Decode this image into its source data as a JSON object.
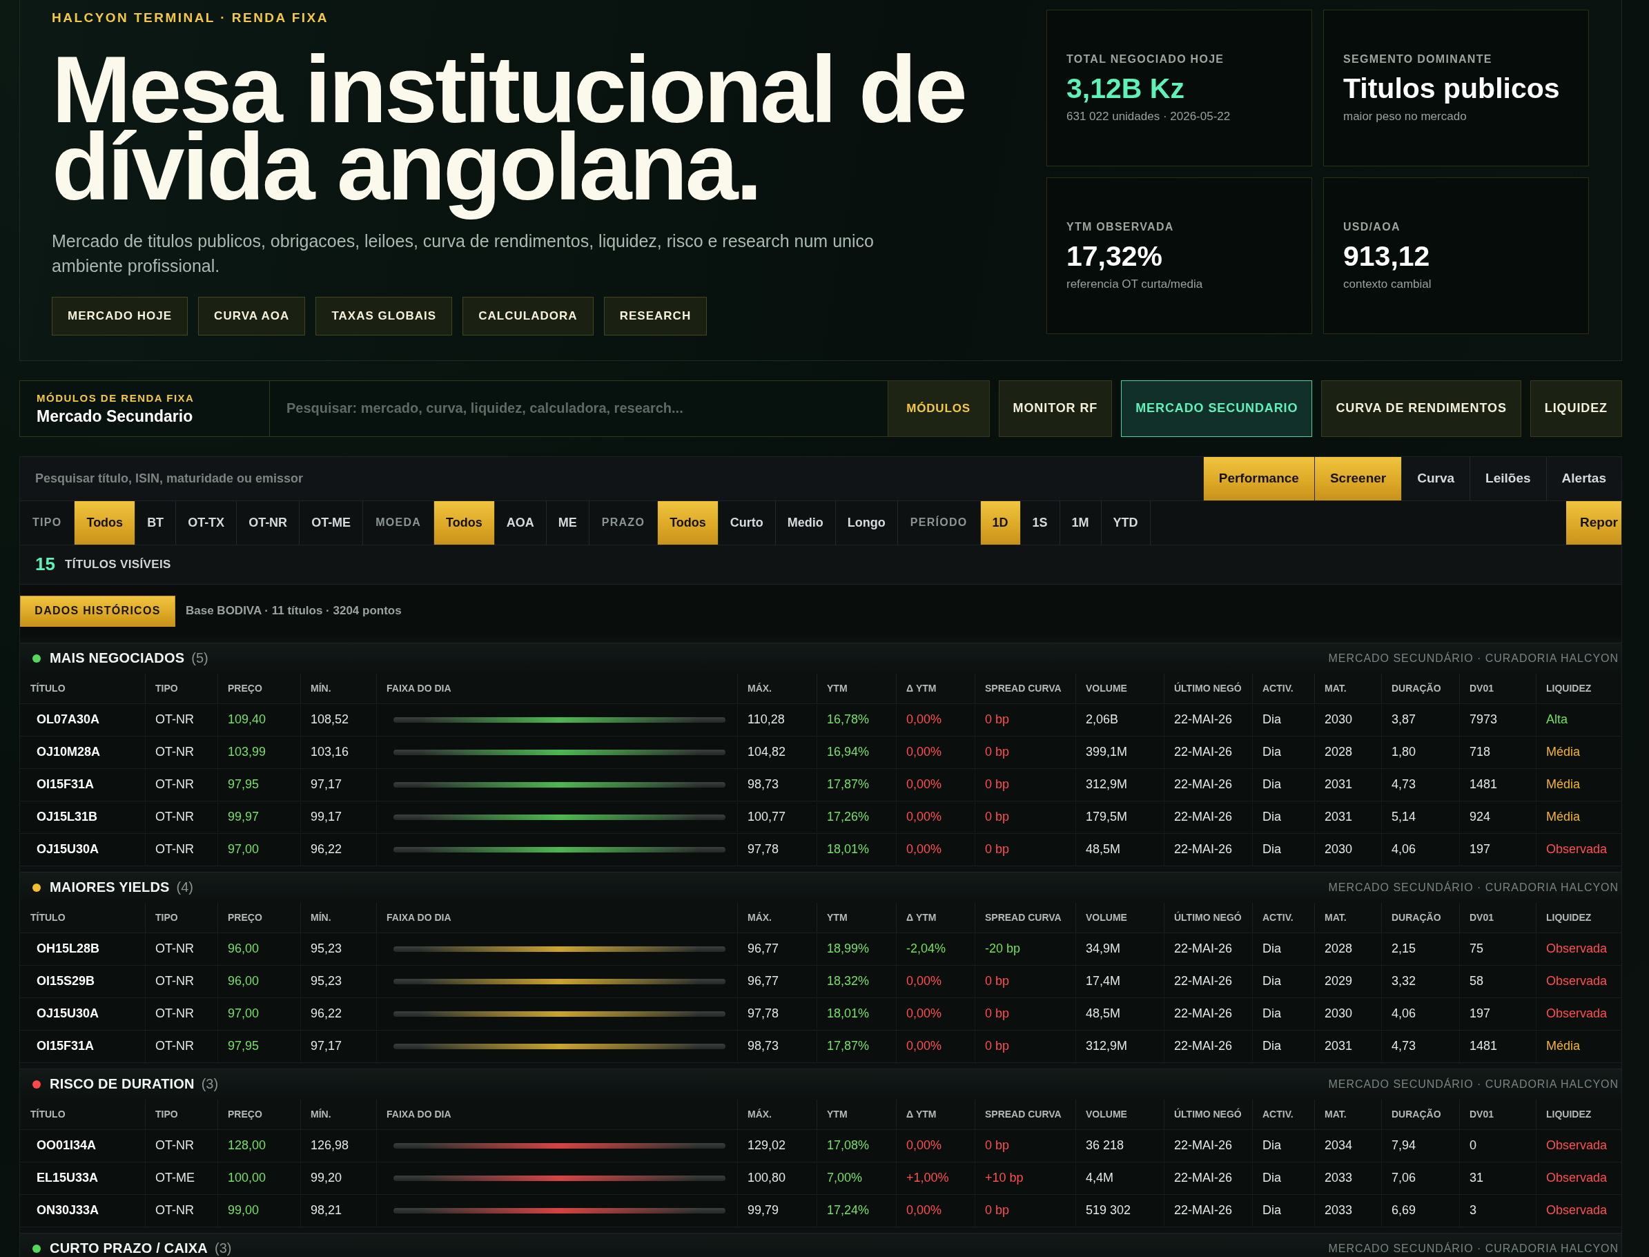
{
  "hero": {
    "kicker": "HALCYON TERMINAL · RENDA FIXA",
    "title": "Mesa institucional de dívida angolana.",
    "subtitle": "Mercado de titulos publicos, obrigacoes, leiloes, curva de rendimentos, liquidez, risco e research num unico ambiente profissional.",
    "buttons": [
      "MERCADO HOJE",
      "CURVA AOA",
      "TAXAS GLOBAIS",
      "CALCULADORA",
      "RESEARCH"
    ]
  },
  "stats": [
    {
      "label": "TOTAL NEGOCIADO HOJE",
      "value": "3,12B Kz",
      "note": "631 022 unidades · 2026-05-22",
      "kind": "accent"
    },
    {
      "label": "SEGMENTO DOMINANTE",
      "value": "Titulos publicos",
      "note": "maior peso no mercado",
      "kind": "plain"
    },
    {
      "label": "YTM OBSERVADA",
      "value": "17,32%",
      "note": "referencia OT curta/media",
      "kind": "plain"
    },
    {
      "label": "USD/AOA",
      "value": "913,12",
      "note": "contexto cambial",
      "kind": "plain"
    }
  ],
  "modules": {
    "kicker": "MÓDULOS DE RENDA FIXA",
    "current": "Mercado Secundario",
    "search": {
      "placeholder": "Pesquisar: mercado, curva, liquidez, calculadora, research..."
    },
    "menu_button": "MÓDULOS",
    "tabs": [
      {
        "label": "MONITOR RF",
        "selected": false
      },
      {
        "label": "MERCADO SECUNDARIO",
        "selected": true
      },
      {
        "label": "CURVA DE RENDIMENTOS",
        "selected": false
      },
      {
        "label": "LIQUIDEZ",
        "selected": false
      }
    ]
  },
  "screener": {
    "search": {
      "placeholder": "Pesquisar título, ISIN, maturidade ou emissor"
    },
    "views": [
      {
        "label": "Performance",
        "selected": true
      },
      {
        "label": "Screener",
        "selected": true
      },
      {
        "label": "Curva",
        "selected": false
      },
      {
        "label": "Leilões",
        "selected": false
      },
      {
        "label": "Alertas",
        "selected": false
      }
    ],
    "filters": [
      {
        "label": "TIPO",
        "options": [
          {
            "label": "Todos",
            "selected": true
          },
          {
            "label": "BT",
            "selected": false
          },
          {
            "label": "OT-TX",
            "selected": false
          },
          {
            "label": "OT-NR",
            "selected": false
          },
          {
            "label": "OT-ME",
            "selected": false
          }
        ]
      },
      {
        "label": "MOEDA",
        "options": [
          {
            "label": "Todos",
            "selected": true
          },
          {
            "label": "AOA",
            "selected": false
          },
          {
            "label": "ME",
            "selected": false
          }
        ]
      },
      {
        "label": "PRAZO",
        "options": [
          {
            "label": "Todos",
            "selected": true
          },
          {
            "label": "Curto",
            "selected": false
          },
          {
            "label": "Medio",
            "selected": false
          },
          {
            "label": "Longo",
            "selected": false
          }
        ]
      },
      {
        "label": "PERÍODO",
        "options": [
          {
            "label": "1D",
            "selected": true
          },
          {
            "label": "1S",
            "selected": false
          },
          {
            "label": "1M",
            "selected": false
          },
          {
            "label": "YTD",
            "selected": false
          }
        ]
      }
    ],
    "reset_button": "Repor",
    "visible_count": "15",
    "visible_label": "TÍTULOS VISÍVEIS",
    "history_button": "DADOS HISTÓRICOS",
    "history_note": "Base BODIVA · 11 títulos · 3204 pontos"
  },
  "sections": [
    {
      "title": "MAIS NEGOCIADOS",
      "count": "(5)",
      "color": "#54d85a",
      "source": "MERCADO SECUNDÁRIO · CURADORIA HALCYON",
      "columns": [
        "TÍTULO",
        "TIPO",
        "PREÇO",
        "MÍN.",
        "FAIXA DO DIA",
        "MÁX.",
        "YTM",
        "Δ YTM",
        "SPREAD CURVA",
        "VOLUME",
        "ÚLTIMO NEGÓ",
        "ACTIV.",
        "MAT.",
        "DURAÇÃO",
        "DV01",
        "LIQUIDEZ"
      ],
      "rows": [
        {
          "titulo": "OL07A30A",
          "tipo": "OT-NR",
          "preco": "109,40",
          "min": "108,52",
          "max": "110,28",
          "ytm": "16,78%",
          "delta_ytm": {
            "text": "0,00%",
            "color": "#ff4f4f"
          },
          "spread_curva": {
            "text": "0 bp",
            "color": "#ff4f4f"
          },
          "volume": "2,06B",
          "ultimo_nego": "22-MAI-26",
          "activ": "Dia",
          "mat": "2030",
          "duracao": "3,87",
          "dv01": "7973",
          "liquidez": {
            "text": "Alta",
            "color": "#74e05a"
          }
        },
        {
          "titulo": "OJ10M28A",
          "tipo": "OT-NR",
          "preco": "103,99",
          "min": "103,16",
          "max": "104,82",
          "ytm": "16,94%",
          "delta_ytm": {
            "text": "0,00%",
            "color": "#ff4f4f"
          },
          "spread_curva": {
            "text": "0 bp",
            "color": "#ff4f4f"
          },
          "volume": "399,1M",
          "ultimo_nego": "22-MAI-26",
          "activ": "Dia",
          "mat": "2028",
          "duracao": "1,80",
          "dv01": "718",
          "liquidez": {
            "text": "Média",
            "color": "#f5b52a"
          }
        },
        {
          "titulo": "OI15F31A",
          "tipo": "OT-NR",
          "preco": "97,95",
          "min": "97,17",
          "max": "98,73",
          "ytm": "17,87%",
          "delta_ytm": {
            "text": "0,00%",
            "color": "#ff4f4f"
          },
          "spread_curva": {
            "text": "0 bp",
            "color": "#ff4f4f"
          },
          "volume": "312,9M",
          "ultimo_nego": "22-MAI-26",
          "activ": "Dia",
          "mat": "2031",
          "duracao": "4,73",
          "dv01": "1481",
          "liquidez": {
            "text": "Média",
            "color": "#f5b52a"
          }
        },
        {
          "titulo": "OJ15L31B",
          "tipo": "OT-NR",
          "preco": "99,97",
          "min": "99,17",
          "max": "100,77",
          "ytm": "17,26%",
          "delta_ytm": {
            "text": "0,00%",
            "color": "#ff4f4f"
          },
          "spread_curva": {
            "text": "0 bp",
            "color": "#ff4f4f"
          },
          "volume": "179,5M",
          "ultimo_nego": "22-MAI-26",
          "activ": "Dia",
          "mat": "2031",
          "duracao": "5,14",
          "dv01": "924",
          "liquidez": {
            "text": "Média",
            "color": "#f5b52a"
          }
        },
        {
          "titulo": "OJ15U30A",
          "tipo": "OT-NR",
          "preco": "97,00",
          "min": "96,22",
          "max": "97,78",
          "ytm": "18,01%",
          "delta_ytm": {
            "text": "0,00%",
            "color": "#ff4f4f"
          },
          "spread_curva": {
            "text": "0 bp",
            "color": "#ff4f4f"
          },
          "volume": "48,5M",
          "ultimo_nego": "22-MAI-26",
          "activ": "Dia",
          "mat": "2030",
          "duracao": "4,06",
          "dv01": "197",
          "liquidez": {
            "text": "Observada",
            "color": "#ff4f4f"
          }
        }
      ]
    },
    {
      "title": "MAIORES YIELDS",
      "count": "(4)",
      "color": "#f2c02e",
      "source": "MERCADO SECUNDÁRIO · CURADORIA HALCYON",
      "columns": [
        "TÍTULO",
        "TIPO",
        "PREÇO",
        "MÍN.",
        "FAIXA DO DIA",
        "MÁX.",
        "YTM",
        "Δ YTM",
        "SPREAD CURVA",
        "VOLUME",
        "ÚLTIMO NEGÓ",
        "ACTIV.",
        "MAT.",
        "DURAÇÃO",
        "DV01",
        "LIQUIDEZ"
      ],
      "rows": [
        {
          "titulo": "OH15L28B",
          "tipo": "OT-NR",
          "preco": "96,00",
          "min": "95,23",
          "max": "96,77",
          "ytm": "18,99%",
          "delta_ytm": {
            "text": "-2,04%",
            "color": "#74e05a"
          },
          "spread_curva": {
            "text": "-20 bp",
            "color": "#74e05a"
          },
          "volume": "34,9M",
          "ultimo_nego": "22-MAI-26",
          "activ": "Dia",
          "mat": "2028",
          "duracao": "2,15",
          "dv01": "75",
          "liquidez": {
            "text": "Observada",
            "color": "#ff4f4f"
          }
        },
        {
          "titulo": "OI15S29B",
          "tipo": "OT-NR",
          "preco": "96,00",
          "min": "95,23",
          "max": "96,77",
          "ytm": "18,32%",
          "delta_ytm": {
            "text": "0,00%",
            "color": "#ff4f4f"
          },
          "spread_curva": {
            "text": "0 bp",
            "color": "#ff4f4f"
          },
          "volume": "17,4M",
          "ultimo_nego": "22-MAI-26",
          "activ": "Dia",
          "mat": "2029",
          "duracao": "3,32",
          "dv01": "58",
          "liquidez": {
            "text": "Observada",
            "color": "#ff4f4f"
          }
        },
        {
          "titulo": "OJ15U30A",
          "tipo": "OT-NR",
          "preco": "97,00",
          "min": "96,22",
          "max": "97,78",
          "ytm": "18,01%",
          "delta_ytm": {
            "text": "0,00%",
            "color": "#ff4f4f"
          },
          "spread_curva": {
            "text": "0 bp",
            "color": "#ff4f4f"
          },
          "volume": "48,5M",
          "ultimo_nego": "22-MAI-26",
          "activ": "Dia",
          "mat": "2030",
          "duracao": "4,06",
          "dv01": "197",
          "liquidez": {
            "text": "Observada",
            "color": "#ff4f4f"
          }
        },
        {
          "titulo": "OI15F31A",
          "tipo": "OT-NR",
          "preco": "97,95",
          "min": "97,17",
          "max": "98,73",
          "ytm": "17,87%",
          "delta_ytm": {
            "text": "0,00%",
            "color": "#ff4f4f"
          },
          "spread_curva": {
            "text": "0 bp",
            "color": "#ff4f4f"
          },
          "volume": "312,9M",
          "ultimo_nego": "22-MAI-26",
          "activ": "Dia",
          "mat": "2031",
          "duracao": "4,73",
          "dv01": "1481",
          "liquidez": {
            "text": "Média",
            "color": "#f5b52a"
          }
        }
      ]
    },
    {
      "title": "RISCO DE DURATION",
      "count": "(3)",
      "color": "#ff4747",
      "source": "MERCADO SECUNDÁRIO · CURADORIA HALCYON",
      "columns": [
        "TÍTULO",
        "TIPO",
        "PREÇO",
        "MÍN.",
        "FAIXA DO DIA",
        "MÁX.",
        "YTM",
        "Δ YTM",
        "SPREAD CURVA",
        "VOLUME",
        "ÚLTIMO NEGÓ",
        "ACTIV.",
        "MAT.",
        "DURAÇÃO",
        "DV01",
        "LIQUIDEZ"
      ],
      "rows": [
        {
          "titulo": "OO01I34A",
          "tipo": "OT-NR",
          "preco": "128,00",
          "min": "126,98",
          "max": "129,02",
          "ytm": "17,08%",
          "delta_ytm": {
            "text": "0,00%",
            "color": "#ff4f4f"
          },
          "spread_curva": {
            "text": "0 bp",
            "color": "#ff4f4f"
          },
          "volume": "36 218",
          "ultimo_nego": "22-MAI-26",
          "activ": "Dia",
          "mat": "2034",
          "duracao": "7,94",
          "dv01": "0",
          "liquidez": {
            "text": "Observada",
            "color": "#ff4f4f"
          }
        },
        {
          "titulo": "EL15U33A",
          "tipo": "OT-ME",
          "preco": "100,00",
          "min": "99,20",
          "max": "100,80",
          "ytm": "7,00%",
          "delta_ytm": {
            "text": "+1,00%",
            "color": "#ff4f4f"
          },
          "spread_curva": {
            "text": "+10 bp",
            "color": "#ff4f4f"
          },
          "volume": "4,4M",
          "ultimo_nego": "22-MAI-26",
          "activ": "Dia",
          "mat": "2033",
          "duracao": "7,06",
          "dv01": "31",
          "liquidez": {
            "text": "Observada",
            "color": "#ff4f4f"
          }
        },
        {
          "titulo": "ON30J33A",
          "tipo": "OT-NR",
          "preco": "99,00",
          "min": "98,21",
          "max": "99,79",
          "ytm": "17,24%",
          "delta_ytm": {
            "text": "0,00%",
            "color": "#ff4f4f"
          },
          "spread_curva": {
            "text": "0 bp",
            "color": "#ff4f4f"
          },
          "volume": "519 302",
          "ultimo_nego": "22-MAI-26",
          "activ": "Dia",
          "mat": "2033",
          "duracao": "6,69",
          "dv01": "3",
          "liquidez": {
            "text": "Observada",
            "color": "#ff4f4f"
          }
        }
      ]
    },
    {
      "title": "CURTO PRAZO / CAIXA",
      "count": "(3)",
      "color": "#54d85a",
      "source": "MERCADO SECUNDÁRIO · CURADORIA HALCYON"
    }
  ]
}
